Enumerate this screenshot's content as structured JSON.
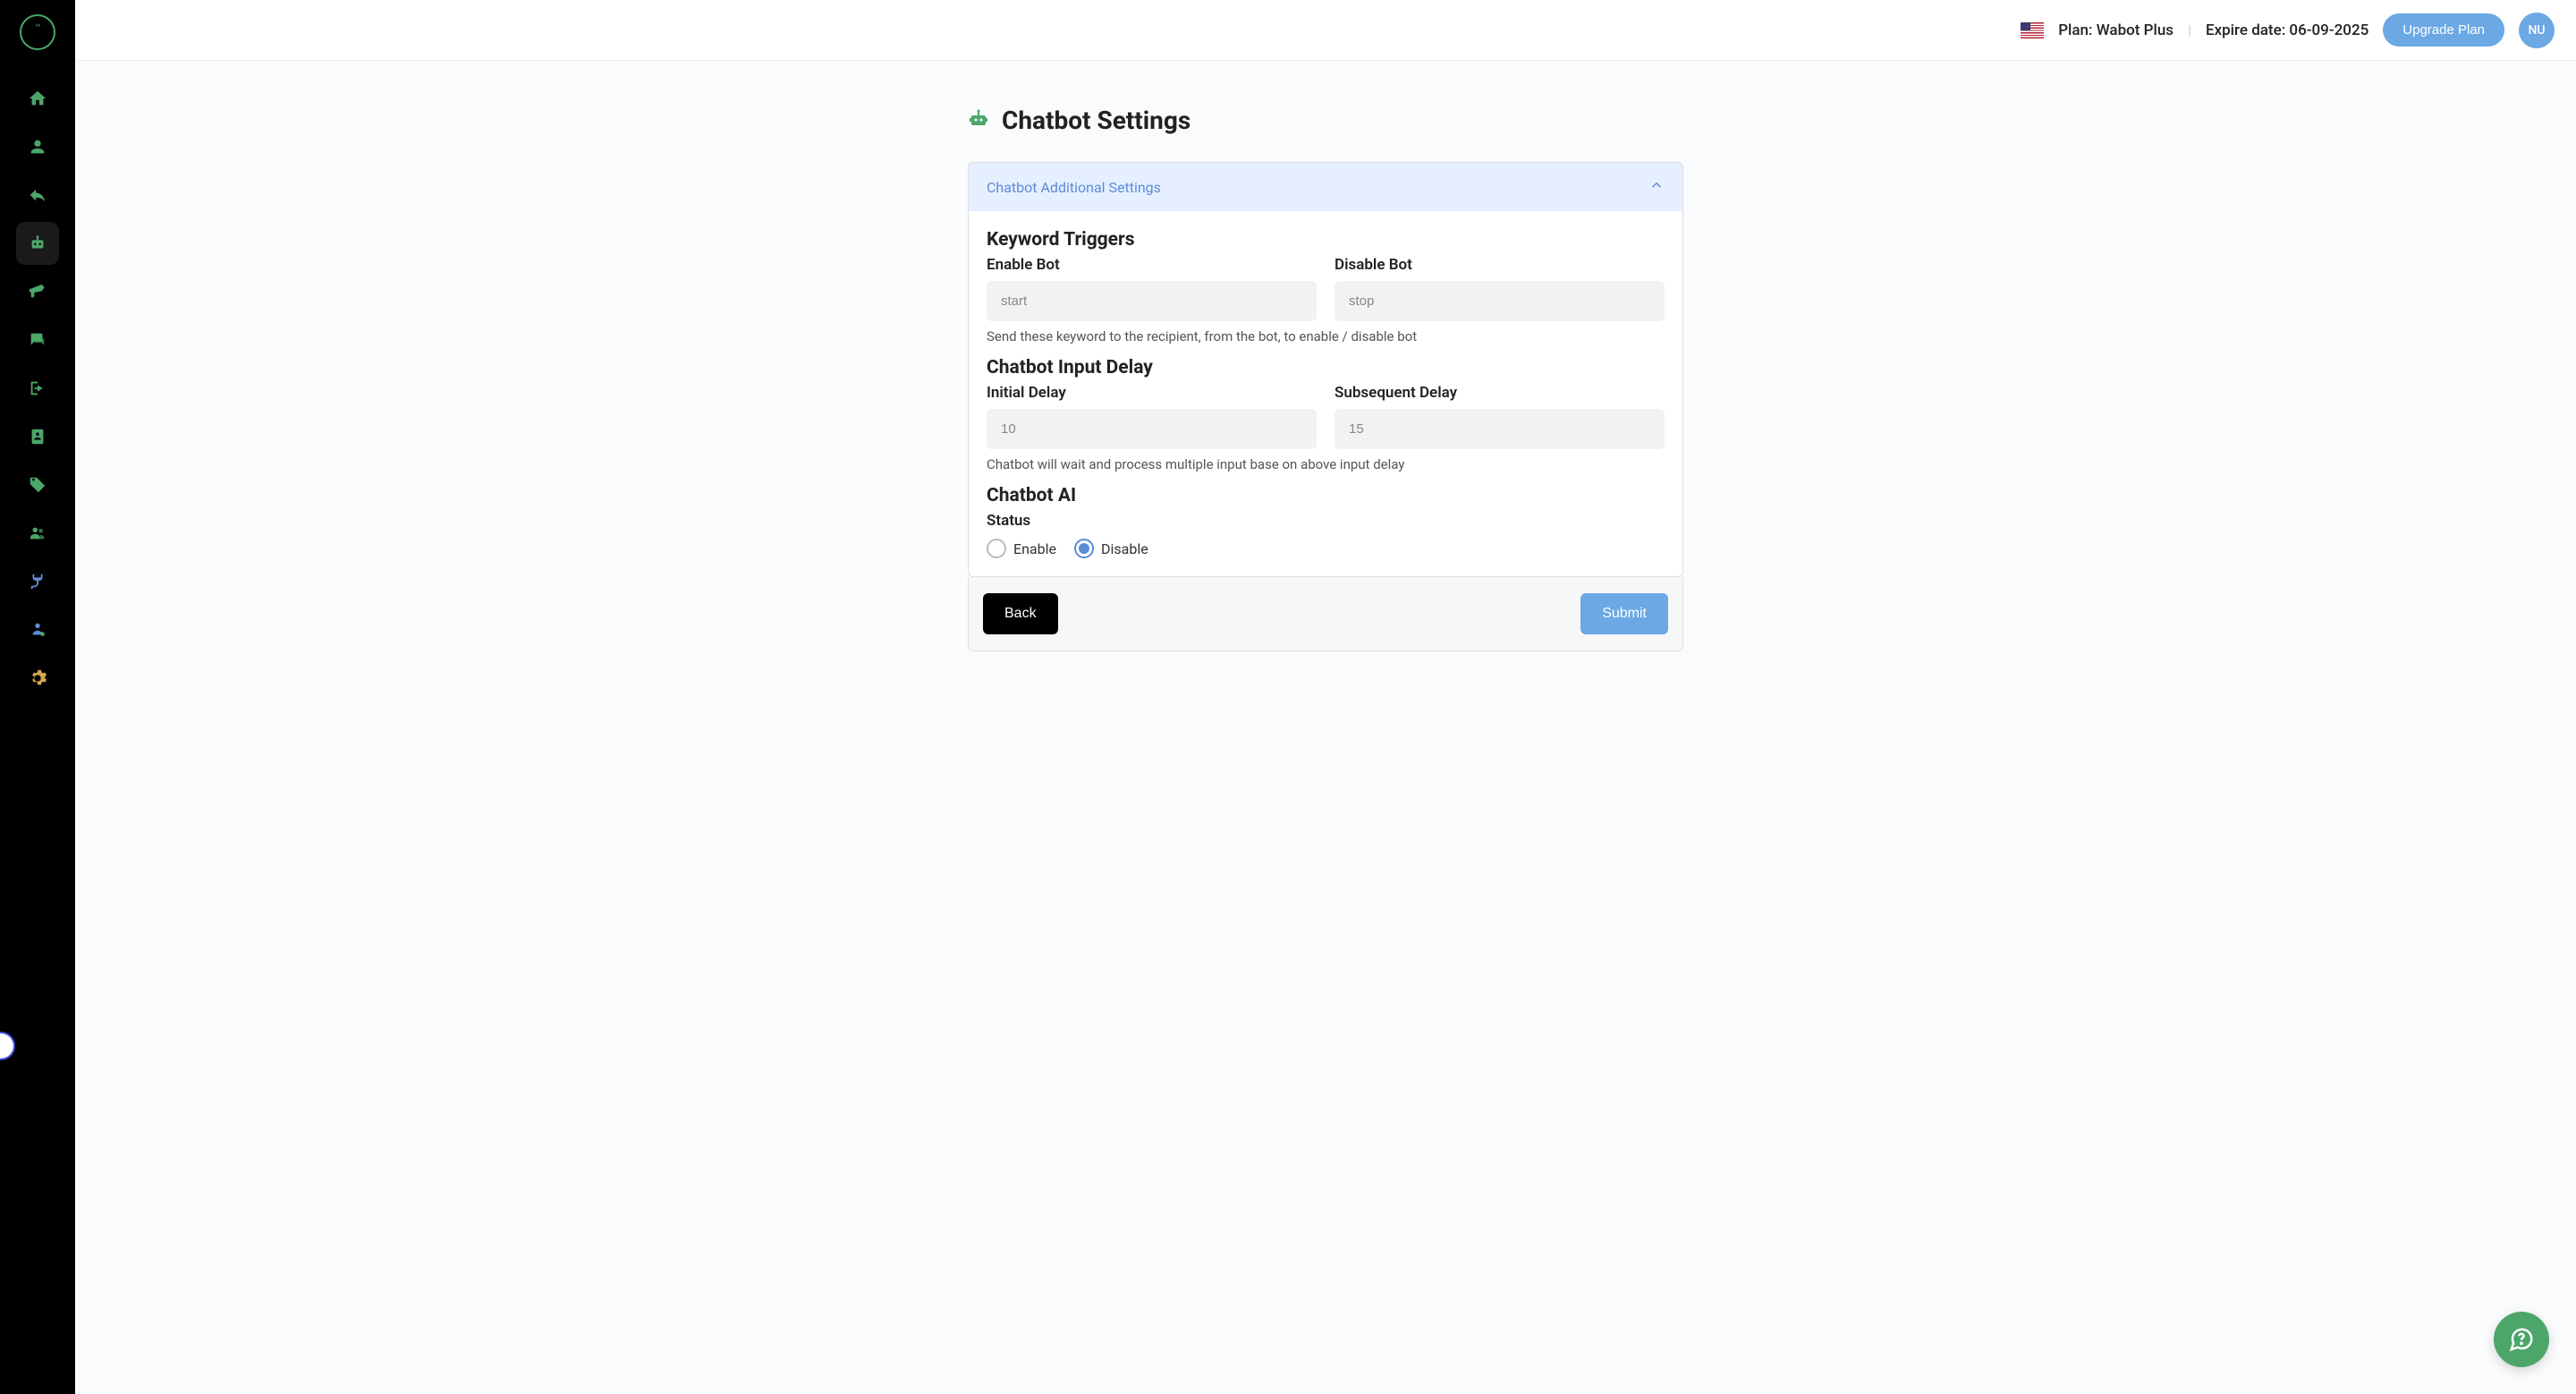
{
  "header": {
    "plan_label": "Plan: Wabot Plus",
    "expire_label": "Expire date: 06-09-2025",
    "upgrade_label": "Upgrade Plan",
    "avatar_initials": "NU"
  },
  "page": {
    "title": "Chatbot Settings"
  },
  "panel": {
    "header": "Chatbot Additional Settings",
    "keyword_triggers": {
      "title": "Keyword Triggers",
      "enable_label": "Enable Bot",
      "enable_value": "start",
      "disable_label": "Disable Bot",
      "disable_value": "stop",
      "help": "Send these keyword to the recipient, from the bot, to enable / disable bot"
    },
    "input_delay": {
      "title": "Chatbot Input Delay",
      "initial_label": "Initial Delay",
      "initial_value": "10",
      "subsequent_label": "Subsequent Delay",
      "subsequent_value": "15",
      "help": "Chatbot will wait and process multiple input base on above input delay"
    },
    "ai": {
      "title": "Chatbot AI",
      "status_label": "Status",
      "enable_label": "Enable",
      "disable_label": "Disable",
      "selected": "disable"
    }
  },
  "footer": {
    "back_label": "Back",
    "submit_label": "Submit"
  }
}
